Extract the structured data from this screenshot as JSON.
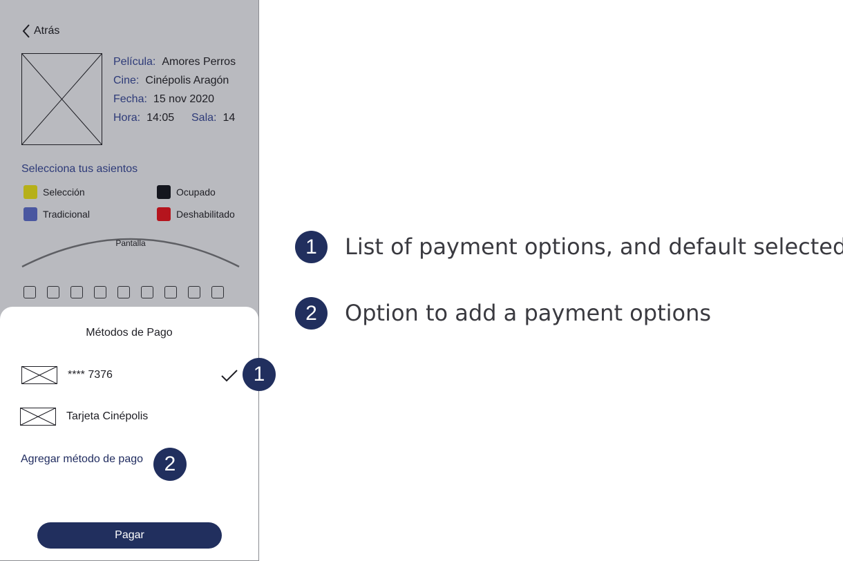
{
  "app": {
    "back": {
      "label": "Atrás",
      "icon": "chevron-left-icon"
    },
    "poster": {
      "icon": "image-placeholder-icon"
    },
    "movie_info": {
      "pelicula": {
        "label": "Película:",
        "value": "Amores Perros"
      },
      "cine": {
        "label": "Cine:",
        "value": "Cinépolis Aragón"
      },
      "fecha": {
        "label": "Fecha:",
        "value": "15 nov 2020"
      },
      "hora": {
        "label": "Hora:",
        "value": "14:05"
      },
      "sala": {
        "label": "Sala:",
        "value": "14"
      }
    },
    "seats_section": {
      "title": "Selecciona tus asientos",
      "legend": [
        {
          "label": "Selección",
          "color": "#b6b019"
        },
        {
          "label": "Ocupado",
          "color": "#14161e"
        },
        {
          "label": "Tradicional",
          "color": "#4a57a0"
        },
        {
          "label": "Deshabilitado",
          "color": "#b5141d"
        }
      ],
      "screen_label": "Pantalla",
      "visible_seat_count": 9
    },
    "payment_sheet": {
      "title": "Métodos de Pago",
      "methods": [
        {
          "label": "**** 7376",
          "selected": true,
          "icon": "card-placeholder-icon"
        },
        {
          "label": "Tarjeta Cinépolis",
          "selected": false,
          "icon": "card-placeholder-icon"
        }
      ],
      "add_method_label": "Agregar método de pago",
      "pay_button_label": "Pagar"
    }
  },
  "annotations": {
    "markers": [
      "1",
      "2"
    ],
    "notes": [
      {
        "number": "1",
        "text": "List of payment options, and default selected"
      },
      {
        "number": "2",
        "text": "Option to add a payment options"
      }
    ]
  },
  "colors": {
    "overlay_gray": "#b9babf",
    "accent_navy": "#212f5e",
    "label_blue": "#2d3a78"
  }
}
